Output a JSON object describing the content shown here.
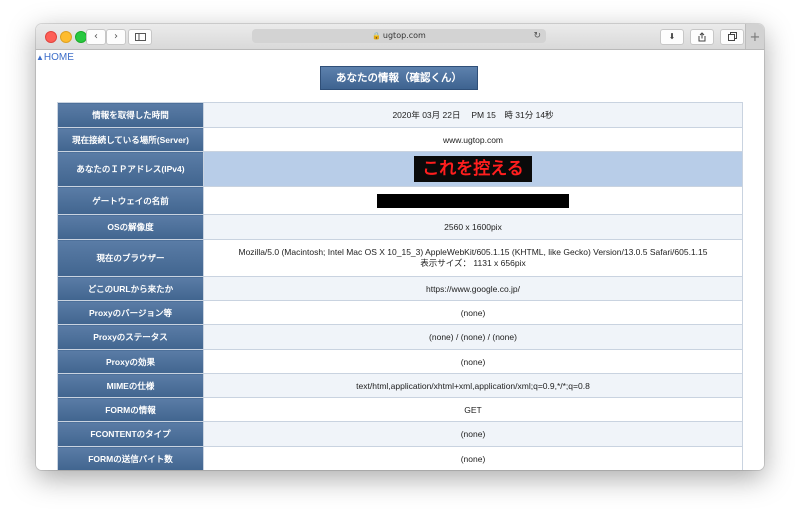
{
  "browser": {
    "url": "ugtop.com",
    "back": "‹",
    "forward": "›"
  },
  "page": {
    "home_link": "HOME",
    "title": "あなたの情報（確認くん）",
    "ip_annotation": "これを控える"
  },
  "rows": [
    {
      "label": "情報を取得した時間",
      "value": "2020年 03月 22日　 PM 15　時 31分 14秒"
    },
    {
      "label": "現在接続している場所(Server)",
      "value": "www.ugtop.com"
    },
    {
      "label": "あなたのＩＰアドレス(IPv4)",
      "value": ""
    },
    {
      "label": "ゲートウェイの名前",
      "value": ""
    },
    {
      "label": "OSの解像度",
      "value": "2560 x 1600pix"
    },
    {
      "label": "現在のブラウザー",
      "value": "Mozilla/5.0 (Macintosh; Intel Mac OS X 10_15_3) AppleWebKit/605.1.15 (KHTML, like Gecko) Version/13.0.5 Safari/605.1.15",
      "value2": "表示サイズ： 1131 x 656pix"
    },
    {
      "label": "どこのURLから来たか",
      "value": "https://www.google.co.jp/"
    },
    {
      "label": "Proxyのバージョン等",
      "value": "(none)"
    },
    {
      "label": "Proxyのステータス",
      "value": "(none) / (none) / (none)"
    },
    {
      "label": "Proxyの効果",
      "value": "(none)"
    },
    {
      "label": "MIMEの仕様",
      "value": "text/html,application/xhtml+xml,application/xml;q=0.9,*/*;q=0.8"
    },
    {
      "label": "FORMの情報",
      "value": "GET"
    },
    {
      "label": "FCONTENTのタイプ",
      "value": "(none)"
    },
    {
      "label": "FORMの送信バイト数",
      "value": "(none)"
    }
  ],
  "colors": {
    "header_blue": "#41658f",
    "highlight_row": "#b8cde8",
    "annotation_red": "#ff1e1e"
  }
}
